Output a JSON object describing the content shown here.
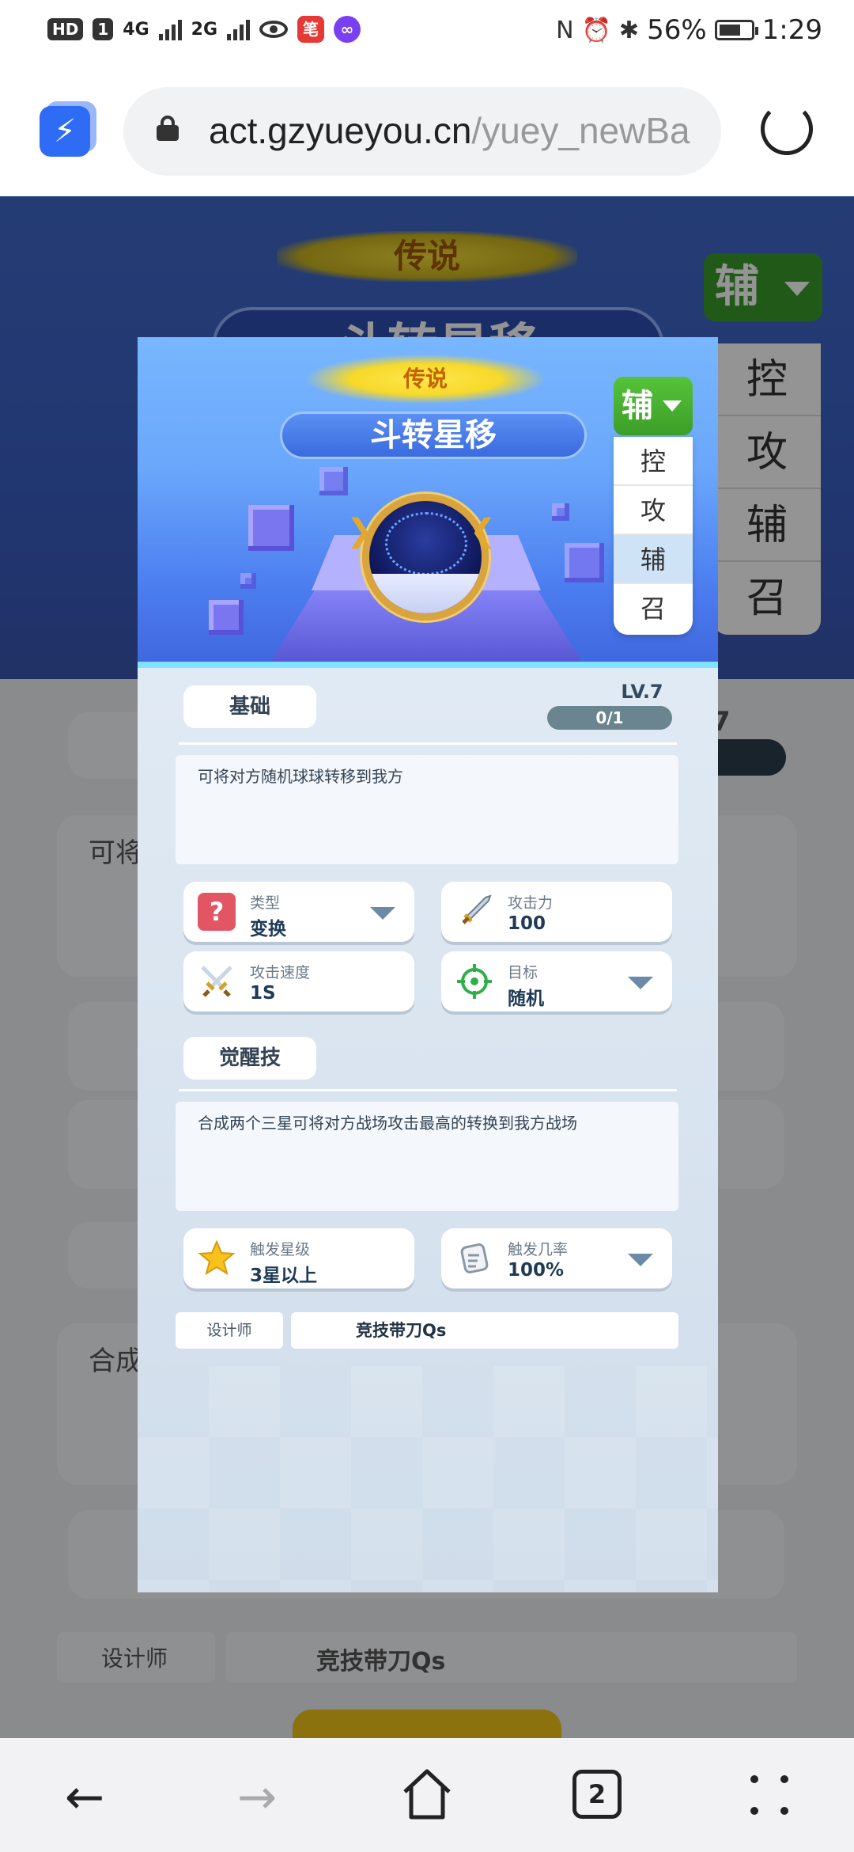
{
  "status_bar": {
    "hd_label": "HD",
    "sim_label": "1",
    "net1": "4G",
    "net2": "2G",
    "red_app": "笔",
    "purple_app": "∞",
    "nfc": "N",
    "battery_pct": "56%",
    "time": "1:29"
  },
  "browser": {
    "url_main": "act.gzyueyou.cn",
    "url_rest": "/yuey_newBa"
  },
  "background": {
    "rarity": "传说",
    "skill_name": "斗转星移",
    "type_selected": "辅",
    "type_options": [
      "控",
      "攻",
      "辅",
      "召"
    ],
    "desc_snippet": "可将",
    "awaken_snippet": "合成",
    "designer_label": "设计师",
    "designer_value": "竞技带刀Qs",
    "lv_tail": "7"
  },
  "modal": {
    "rarity": "传说",
    "skill_name": "斗转星移",
    "type_selected": "辅",
    "type_options": [
      {
        "label": "控",
        "selected": false
      },
      {
        "label": "攻",
        "selected": false
      },
      {
        "label": "辅",
        "selected": true
      },
      {
        "label": "召",
        "selected": false
      }
    ],
    "basic_tab": "基础",
    "level": "LV.7",
    "progress": "0/1",
    "description": "可将对方随机球球转移到我方",
    "stats": {
      "type_label": "类型",
      "type_value": "变换",
      "attack_label": "攻击力",
      "attack_value": "100",
      "speed_label": "攻击速度",
      "speed_value": "1S",
      "target_label": "目标",
      "target_value": "随机"
    },
    "awaken_tab": "觉醒技",
    "awaken_description": "合成两个三星可将对方战场攻击最高的转换到我方战场",
    "trigger": {
      "star_label": "触发星级",
      "star_value": "3星以上",
      "prob_label": "触发几率",
      "prob_value": "100%"
    },
    "designer_label": "设计师",
    "designer_value": "竞技带刀Qs"
  },
  "nav": {
    "tab_count": "2"
  }
}
